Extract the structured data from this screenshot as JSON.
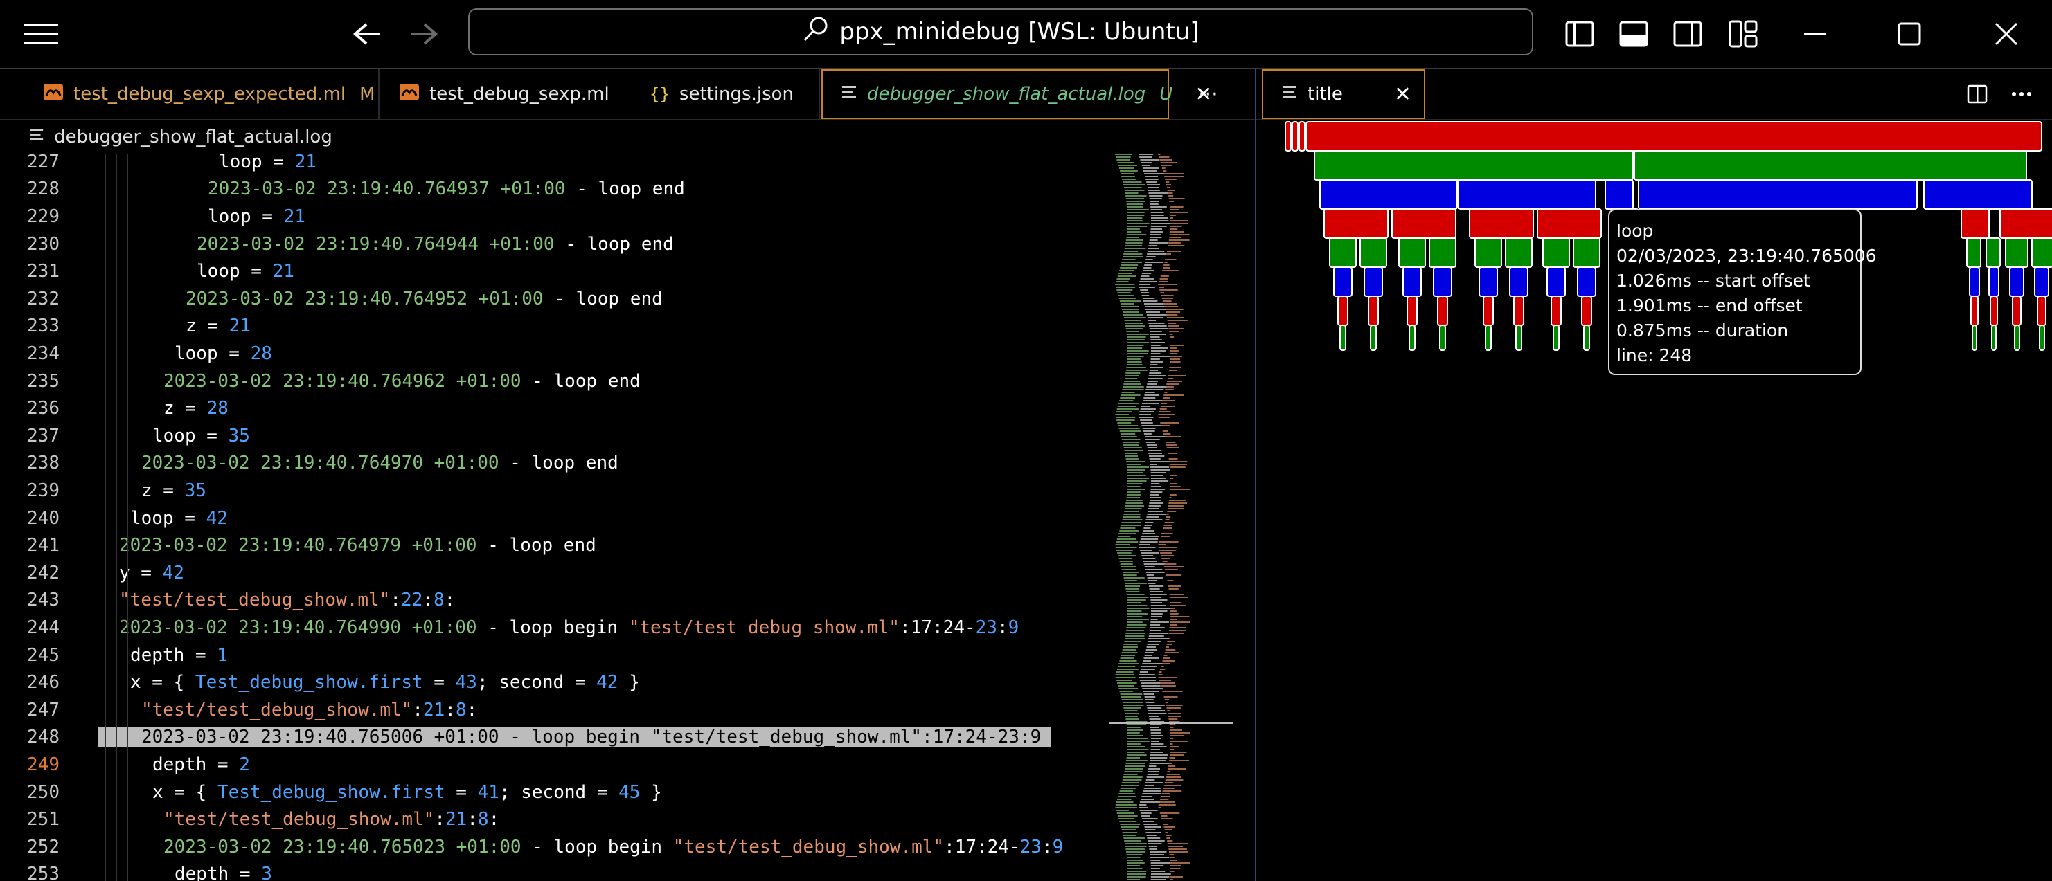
{
  "window": {
    "title": "ppx_minidebug [WSL: Ubuntu]",
    "icons": [
      "menu-icon",
      "back-arrow-icon",
      "forward-arrow-icon",
      "search-icon",
      "toggle-primary-sidebar-icon",
      "toggle-panel-icon",
      "toggle-secondary-sidebar-icon",
      "customize-layout-icon",
      "minimize-icon",
      "maximize-icon",
      "close-icon"
    ]
  },
  "tabs": [
    {
      "label": "test_debug_sexp_expected.ml",
      "badge": "M",
      "icon": "ocaml-file-icon"
    },
    {
      "label": "test_debug_sexp.ml",
      "badge": "",
      "icon": "ocaml-file-icon"
    },
    {
      "label": "settings.json",
      "badge": "",
      "icon": "json-braces-icon"
    },
    {
      "label": "debugger_show_flat_actual.log",
      "badge": "U",
      "icon": "log-file-icon",
      "active": true
    }
  ],
  "more_tabs_label": "···",
  "right_tab": {
    "label": "title"
  },
  "breadcrumb": {
    "file": "debugger_show_flat_actual.log"
  },
  "editor": {
    "lines": [
      {
        "n": "227",
        "indent": 1,
        "parts": [
          {
            "t": "loop = ",
            "c": ""
          },
          {
            "t": "21",
            "c": "num"
          }
        ]
      },
      {
        "n": "228",
        "indent": 1,
        "parts": [
          {
            "t": "2023-03-02 23:19:40.764937 +01:00",
            "c": "ts"
          },
          {
            "t": " - loop end",
            "c": ""
          }
        ]
      },
      {
        "n": "229",
        "indent": 1,
        "parts": [
          {
            "t": "loop = ",
            "c": ""
          },
          {
            "t": "21",
            "c": "num"
          }
        ]
      },
      {
        "n": "230",
        "indent": 1,
        "parts": [
          {
            "t": "2023-03-02 23:19:40.764944 +01:00",
            "c": "ts"
          },
          {
            "t": " - loop end",
            "c": ""
          }
        ]
      },
      {
        "n": "231",
        "indent": 1,
        "parts": [
          {
            "t": "loop = ",
            "c": ""
          },
          {
            "t": "21",
            "c": "num"
          }
        ]
      },
      {
        "n": "232",
        "indent": 1,
        "parts": [
          {
            "t": "2023-03-02 23:19:40.764952 +01:00",
            "c": "ts"
          },
          {
            "t": " - loop end",
            "c": ""
          }
        ]
      },
      {
        "n": "233",
        "indent": 1,
        "parts": [
          {
            "t": "z = ",
            "c": ""
          },
          {
            "t": "21",
            "c": "num"
          }
        ]
      },
      {
        "n": "234",
        "indent": 1,
        "parts": [
          {
            "t": "loop = ",
            "c": ""
          },
          {
            "t": "28",
            "c": "num"
          }
        ]
      },
      {
        "n": "235",
        "indent": 1,
        "parts": [
          {
            "t": "2023-03-02 23:19:40.764962 +01:00",
            "c": "ts"
          },
          {
            "t": " - loop end",
            "c": ""
          }
        ]
      },
      {
        "n": "236",
        "indent": 1,
        "parts": [
          {
            "t": "z = ",
            "c": ""
          },
          {
            "t": "28",
            "c": "num"
          }
        ]
      },
      {
        "n": "237",
        "indent": 1,
        "parts": [
          {
            "t": "loop = ",
            "c": ""
          },
          {
            "t": "35",
            "c": "num"
          }
        ]
      },
      {
        "n": "238",
        "indent": 1,
        "parts": [
          {
            "t": "2023-03-02 23:19:40.764970 +01:00",
            "c": "ts"
          },
          {
            "t": " - loop end",
            "c": ""
          }
        ]
      },
      {
        "n": "239",
        "indent": 1,
        "parts": [
          {
            "t": "z = ",
            "c": ""
          },
          {
            "t": "35",
            "c": "num"
          }
        ]
      },
      {
        "n": "240",
        "indent": 1,
        "parts": [
          {
            "t": "loop = ",
            "c": ""
          },
          {
            "t": "42",
            "c": "num"
          }
        ]
      },
      {
        "n": "241",
        "indent": 1,
        "parts": [
          {
            "t": "2023-03-02 23:19:40.764979 +01:00",
            "c": "ts"
          },
          {
            "t": " - loop end",
            "c": ""
          }
        ]
      },
      {
        "n": "242",
        "indent": 1,
        "parts": [
          {
            "t": "y = ",
            "c": ""
          },
          {
            "t": "42",
            "c": "num"
          }
        ]
      },
      {
        "n": "243",
        "indent": 1,
        "parts": [
          {
            "t": "\"test/test_debug_show.ml\"",
            "c": "str"
          },
          {
            "t": ":",
            "c": ""
          },
          {
            "t": "22",
            "c": "num"
          },
          {
            "t": ":",
            "c": ""
          },
          {
            "t": "8",
            "c": "num"
          },
          {
            "t": ":",
            "c": ""
          }
        ]
      },
      {
        "n": "244",
        "indent": 1,
        "parts": [
          {
            "t": "2023-03-02 23:19:40.764990 +01:00",
            "c": "ts"
          },
          {
            "t": " - loop begin ",
            "c": ""
          },
          {
            "t": "\"test/test_debug_show.ml\"",
            "c": "str"
          },
          {
            "t": ":17:24-",
            "c": ""
          },
          {
            "t": "23",
            "c": "num"
          },
          {
            "t": ":",
            "c": ""
          },
          {
            "t": "9",
            "c": "num"
          }
        ]
      },
      {
        "n": "245",
        "indent": 1,
        "parts": [
          {
            "t": "depth = ",
            "c": ""
          },
          {
            "t": "1",
            "c": "num"
          }
        ]
      },
      {
        "n": "246",
        "indent": 1,
        "parts": [
          {
            "t": "x = { ",
            "c": ""
          },
          {
            "t": "Test_debug_show.first",
            "c": "ident"
          },
          {
            "t": " = ",
            "c": ""
          },
          {
            "t": "43",
            "c": "num"
          },
          {
            "t": "; second = ",
            "c": ""
          },
          {
            "t": "42",
            "c": "num"
          },
          {
            "t": " }",
            "c": ""
          }
        ]
      },
      {
        "n": "247",
        "indent": 1,
        "parts": [
          {
            "t": "\"test/test_debug_show.ml\"",
            "c": "str"
          },
          {
            "t": ":",
            "c": ""
          },
          {
            "t": "21",
            "c": "num"
          },
          {
            "t": ":",
            "c": ""
          },
          {
            "t": "8",
            "c": "num"
          },
          {
            "t": ":",
            "c": ""
          }
        ]
      },
      {
        "n": "248",
        "indent": 1,
        "highlight": true,
        "parts": [
          {
            "t": "2023-03-02 23:19:40.765006 +01:00 - loop begin \"test/test_debug_show.ml\":17:24-23:9",
            "c": ""
          }
        ]
      },
      {
        "n": "249",
        "indent": 1,
        "current": true,
        "parts": [
          {
            "t": "depth = ",
            "c": ""
          },
          {
            "t": "2",
            "c": "num"
          }
        ]
      },
      {
        "n": "250",
        "indent": 1,
        "parts": [
          {
            "t": "x = { ",
            "c": ""
          },
          {
            "t": "Test_debug_show.first",
            "c": "ident"
          },
          {
            "t": " = ",
            "c": ""
          },
          {
            "t": "41",
            "c": "num"
          },
          {
            "t": "; second = ",
            "c": ""
          },
          {
            "t": "45",
            "c": "num"
          },
          {
            "t": " }",
            "c": ""
          }
        ]
      },
      {
        "n": "251",
        "indent": 1,
        "parts": [
          {
            "t": "\"test/test_debug_show.ml\"",
            "c": "str"
          },
          {
            "t": ":",
            "c": ""
          },
          {
            "t": "21",
            "c": "num"
          },
          {
            "t": ":",
            "c": ""
          },
          {
            "t": "8",
            "c": "num"
          },
          {
            "t": ":",
            "c": ""
          }
        ]
      },
      {
        "n": "252",
        "indent": 1,
        "parts": [
          {
            "t": "2023-03-02 23:19:40.765023 +01:00",
            "c": "ts"
          },
          {
            "t": " - loop begin ",
            "c": ""
          },
          {
            "t": "\"test/test_debug_show.ml\"",
            "c": "str"
          },
          {
            "t": ":17:24-",
            "c": ""
          },
          {
            "t": "23",
            "c": "num"
          },
          {
            "t": ":",
            "c": ""
          },
          {
            "t": "9",
            "c": "num"
          }
        ]
      },
      {
        "n": "253",
        "indent": 1,
        "parts": [
          {
            "t": "depth = ",
            "c": ""
          },
          {
            "t": "3",
            "c": "num"
          }
        ]
      }
    ]
  },
  "tooltip": {
    "name": "loop",
    "time": "02/03/2023, 23:19:40.765006",
    "start": "1.026ms -- start offset",
    "end": "1.901ms -- end offset",
    "duration": "0.875ms -- duration",
    "line": "line: 248"
  },
  "colors": {
    "accent": "#c98028",
    "timestamp": "#86c37a",
    "number": "#4fa3ff",
    "string": "#e6926a",
    "flame_red": "#d40000",
    "flame_green": "#008a00",
    "flame_blue": "#0000e0"
  }
}
